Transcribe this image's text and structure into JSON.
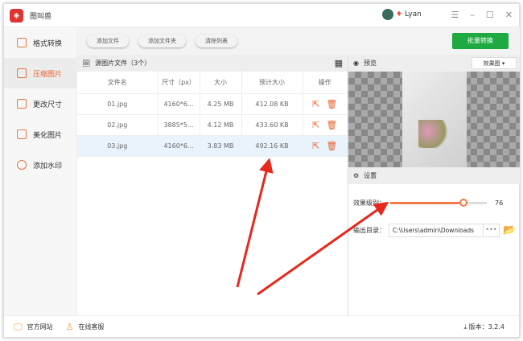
{
  "app": {
    "title": "图叫兽",
    "user": "Lyan"
  },
  "sidebar": {
    "items": [
      {
        "label": "格式转换"
      },
      {
        "label": "压缩图片"
      },
      {
        "label": "更改尺寸"
      },
      {
        "label": "美化图片"
      },
      {
        "label": "添加水印"
      }
    ],
    "active": 1
  },
  "toolbar": {
    "add_file": "添加文件",
    "add_folder": "添加文件夹",
    "clear": "清除列表",
    "batch": "批量转换"
  },
  "list": {
    "title": "源图片文件（3个）",
    "columns": [
      "文件名",
      "尺寸（px）",
      "大小",
      "预计大小",
      "操作"
    ],
    "rows": [
      {
        "name": "01.jpg",
        "dims": "4160*6...",
        "size": "4.25 MB",
        "est": "412.08 KB"
      },
      {
        "name": "02.jpg",
        "dims": "3885*5...",
        "size": "4.12 MB",
        "est": "433.60 KB"
      },
      {
        "name": "03.jpg",
        "dims": "4160*6...",
        "size": "3.83 MB",
        "est": "492.16 KB"
      }
    ],
    "selected": 2
  },
  "preview": {
    "title": "预览",
    "mode": "效果图"
  },
  "settings": {
    "title": "设置",
    "quality_label": "效果级别：",
    "quality": 76,
    "output_label": "输出目录：",
    "output_path": "C:\\Users\\admin\\Downloads",
    "browse": "•••"
  },
  "footer": {
    "website": "官方网站",
    "support": "在线客服",
    "version": "版本：3.2.4"
  },
  "colors": {
    "accent": "#e8622d",
    "batch": "#1eaa40",
    "arrow": "#e8281e"
  }
}
